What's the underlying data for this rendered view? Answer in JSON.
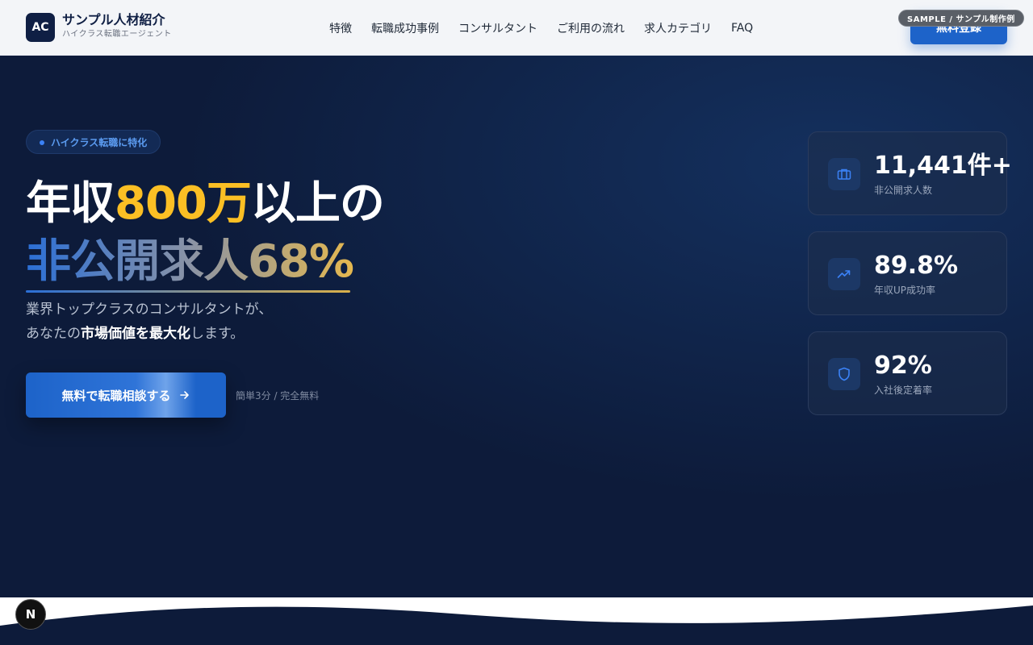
{
  "header": {
    "logo_text": "AC",
    "brand_name": "サンプル人材紹介",
    "brand_sub": "ハイクラス転職エージェント",
    "nav": [
      "特徴",
      "転職成功事例",
      "コンサルタント",
      "ご利用の流れ",
      "求人カテゴリ",
      "FAQ"
    ],
    "cta_label": "無料登録",
    "sample_badge": "SAMPLE / サンプル制作例"
  },
  "hero": {
    "pill_label": "ハイクラス転職に特化",
    "title_pre": "年収",
    "title_highlight": "800万",
    "title_post": "以上の",
    "title_line2": "非公開求人68%",
    "lead_line1": "業界トップクラスのコンサルタントが、",
    "lead_line2_pre": "あなたの",
    "lead_line2_bold": "市場価値を最大化",
    "lead_line2_post": "します。",
    "cta_label": "無料で転職相談する",
    "cta_note": "簡単3分 / 完全無料"
  },
  "stats": [
    {
      "value": "11,441件+",
      "label": "非公開求人数",
      "icon": "briefcase-icon"
    },
    {
      "value": "89.8%",
      "label": "年収UP成功率",
      "icon": "trending-up-icon"
    },
    {
      "value": "92%",
      "label": "入社後定着率",
      "icon": "shield-icon"
    }
  ],
  "badge": {
    "letter": "N"
  },
  "colors": {
    "navy": "#0d1b3a",
    "accent": "#1d63c9",
    "gold": "#fbbf24"
  }
}
